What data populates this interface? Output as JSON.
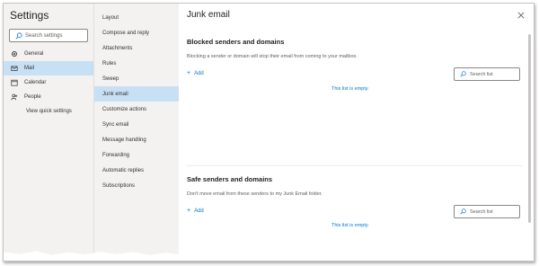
{
  "sidebar": {
    "title": "Settings",
    "search_placeholder": "Search settings",
    "items": [
      {
        "label": "General"
      },
      {
        "label": "Mail"
      },
      {
        "label": "Calendar"
      },
      {
        "label": "People"
      },
      {
        "label": "View quick settings"
      }
    ]
  },
  "subnav": {
    "items": [
      {
        "label": "Layout"
      },
      {
        "label": "Compose and reply"
      },
      {
        "label": "Attachments"
      },
      {
        "label": "Rules"
      },
      {
        "label": "Sweep"
      },
      {
        "label": "Junk email"
      },
      {
        "label": "Customize actions"
      },
      {
        "label": "Sync email"
      },
      {
        "label": "Message handling"
      },
      {
        "label": "Forwarding"
      },
      {
        "label": "Automatic replies"
      },
      {
        "label": "Subscriptions"
      }
    ]
  },
  "main": {
    "title": "Junk email",
    "blocked": {
      "heading": "Blocked senders and domains",
      "description": "Blocking a sender or domain will stop their email from coming to your mailbox.",
      "add_label": "Add",
      "search_placeholder": "Search list",
      "empty_text": "This list is empty."
    },
    "safe": {
      "heading": "Safe senders and domains",
      "description": "Don't move email from these senders to my Junk Email folder.",
      "add_label": "Add",
      "search_placeholder": "Search list",
      "empty_text": "This list is empty."
    }
  },
  "icons": {
    "general": "gear-icon",
    "mail": "mail-icon",
    "calendar": "calendar-icon",
    "people": "people-icon",
    "search": "search-icon",
    "close": "close-icon"
  },
  "colors": {
    "accent": "#0078d4",
    "selected_bg": "#c7e0f4",
    "sidebar_bg": "#f3f2f1"
  }
}
